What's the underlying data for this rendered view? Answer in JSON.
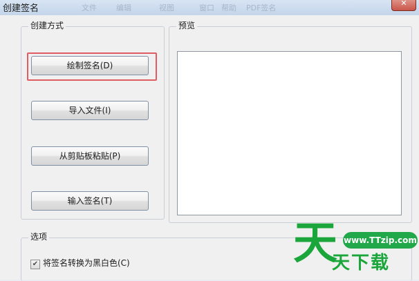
{
  "window": {
    "title": "创建签名",
    "close_label": "✕",
    "background_tabs": [
      "文件",
      "编辑",
      "视图",
      "窗口",
      "帮助",
      "PDF签名"
    ]
  },
  "create_method": {
    "group_title": "创建方式",
    "buttons": [
      {
        "label": "绘制签名(D)",
        "focused": true
      },
      {
        "label": "导入文件(I)",
        "focused": false
      },
      {
        "label": "从剪贴板粘贴(P)",
        "focused": false
      },
      {
        "label": "输入签名(T)",
        "focused": false
      }
    ]
  },
  "preview": {
    "group_title": "预览"
  },
  "options": {
    "group_title": "选项",
    "checkbox_label": "将签名转换为黑白色(C)",
    "checkbox_checked": true
  },
  "watermark": {
    "logo_char": "天",
    "url": "www.TTzip.com",
    "text": "天下载"
  },
  "colors": {
    "focus_outline": "#e05c63",
    "watermark_green": "#1aa63a"
  }
}
